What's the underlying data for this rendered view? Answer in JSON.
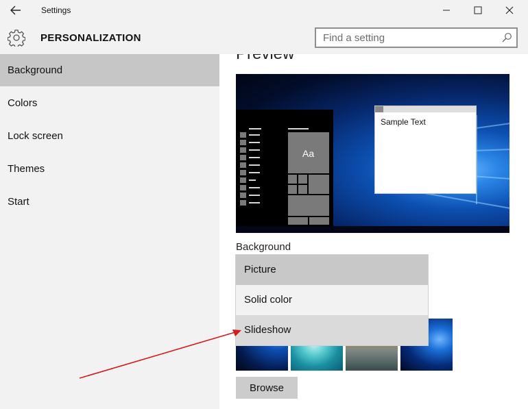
{
  "window": {
    "title": "Settings",
    "minimize_icon": "minimize-icon",
    "maximize_icon": "maximize-icon",
    "close_icon": "close-icon"
  },
  "header": {
    "title": "PERSONALIZATION",
    "icon": "gear-icon",
    "search": {
      "placeholder": "Find a setting",
      "value": ""
    }
  },
  "sidebar": {
    "items": [
      {
        "label": "Background",
        "selected": true
      },
      {
        "label": "Colors",
        "selected": false
      },
      {
        "label": "Lock screen",
        "selected": false
      },
      {
        "label": "Themes",
        "selected": false
      },
      {
        "label": "Start",
        "selected": false
      }
    ]
  },
  "main": {
    "preview_heading": "Preview",
    "preview": {
      "sample_text": "Sample Text",
      "tile_text": "Aa"
    },
    "background_label": "Background",
    "dropdown": {
      "options": [
        "Picture",
        "Solid color",
        "Slideshow"
      ],
      "selected": "Picture",
      "highlighted": "Slideshow"
    },
    "browse_label": "Browse"
  },
  "colors": {
    "chrome": "#f2f2f2",
    "selected_nav": "#c6c6c6",
    "annotation_arrow": "#d41a1a"
  }
}
